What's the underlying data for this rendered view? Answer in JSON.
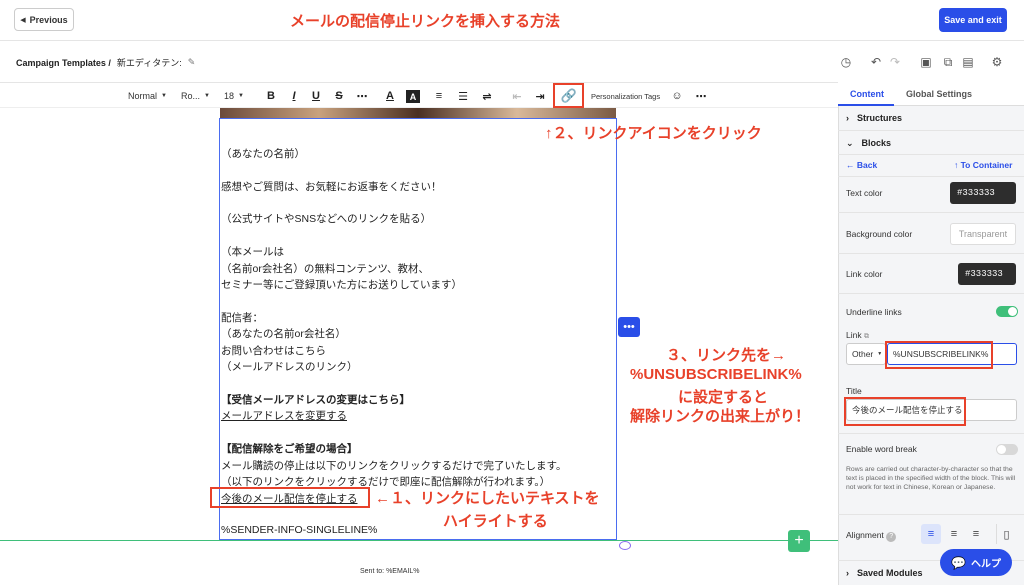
{
  "topbar": {
    "previous_label": "Previous",
    "save_label": "Save and exit",
    "annotation_title": "メールの配信停止リンクを挿入する方法"
  },
  "breadcrumb": {
    "root": "Campaign Templates /",
    "current": "新エディタテン:"
  },
  "toolbar": {
    "style": "Normal",
    "font": "Ro...",
    "size": "18",
    "personalization": "Personalization Tags"
  },
  "email_body": {
    "lines": [
      "（あなたの名前）",
      "感想やご質問は、お気軽にお返事をください！",
      "（公式サイトやSNSなどへのリンクを貼る）",
      "（本メールは",
      "（名前or会社名）の無料コンテンツ、教材、",
      "セミナー等にご登録頂いた方にお送りしています）",
      "配信者：",
      "（あなたの名前or会社名）",
      "お問い合わせはこちら",
      "（メールアドレスのリンク）",
      "【受信メールアドレスの変更はこちら】",
      "メールアドレスを変更する",
      "【配信解除をご希望の場合】",
      "メール購読の停止は以下のリンクをクリックするだけで完了いたします。",
      "（以下のリンクをクリックするだけで即座に配信解除が行われます。）",
      "今後のメール配信を停止する",
      "%SENDER-INFO-SINGLELINE%"
    ],
    "sent_to": "Sent to: %EMAIL%"
  },
  "annotations": {
    "step1_a": "←１、リンクにしたいテキストを",
    "step1_b": "ハイライトする",
    "step2": "↑２、リンクアイコンをクリック",
    "step3_a": "３、リンク先を→",
    "step3_b": "%UNSUBSCRIBELINK%",
    "step3_c": "に設定すると",
    "step3_d": "解除リンクの出来上がり！"
  },
  "panel": {
    "tab_content": "Content",
    "tab_global": "Global Settings",
    "structures": "Structures",
    "blocks": "Blocks",
    "back": "Back",
    "to_container": "To Container",
    "text_color_label": "Text color",
    "text_color_value": "#333333",
    "bg_color_label": "Background color",
    "bg_color_value": "Transparent",
    "link_color_label": "Link color",
    "link_color_value": "#333333",
    "underline_label": "Underline links",
    "underline_on": true,
    "link_label": "Link",
    "link_type": "Other",
    "link_value": "%UNSUBSCRIBELINK%",
    "title_label": "Title",
    "title_value": "今後のメール配信を停止する",
    "word_break_label": "Enable word break",
    "word_break_on": false,
    "word_break_hint": "Rows are carried out character-by-character so that the text is placed in the specified width of the block. This will not work for text in Chinese, Korean or Japanese.",
    "alignment_label": "Alignment",
    "saved_modules": "Saved Modules",
    "help_label": "ヘルプ"
  },
  "colors": {
    "accent": "#2a4ee8",
    "annotation_red": "#e8412a",
    "toggle_green": "#3fbf7a"
  }
}
